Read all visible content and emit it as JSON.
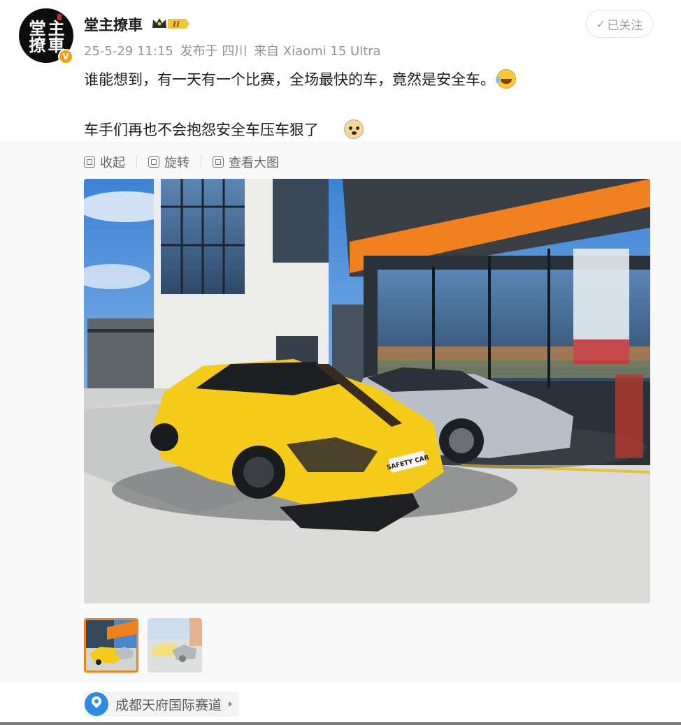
{
  "post": {
    "author": {
      "name": "堂主撩車",
      "avatar_text": [
        "堂",
        "主",
        "撩",
        "車"
      ],
      "verified_badge": "V",
      "vip_badge": "II"
    },
    "meta": {
      "date": "25-5-29 11:15",
      "published_at": "发布于 四川",
      "device": "来自 Xiaomi 15 Ultra"
    },
    "follow_button": "已关注",
    "text_line1": "谁能想到，有一天有一个比赛，全场最快的车，竟然是安全车。",
    "text_line2": "车手们再也不会抱怨安全车压车狠了",
    "emojis": [
      "laughing-tears-emoji",
      "doge-emoji"
    ]
  },
  "toolbar": {
    "collapse": "收起",
    "rotate": "旋转",
    "view_large": "查看大图"
  },
  "photo": {
    "license_plate": "SAFETY CAR",
    "thumbnail_count": 2,
    "selected_thumbnail": 1
  },
  "location": {
    "label": "成都天府国际赛道"
  },
  "colors": {
    "accent_orange": "#f08321",
    "location_blue": "#2f8ae5",
    "meta_gray": "#939393"
  }
}
